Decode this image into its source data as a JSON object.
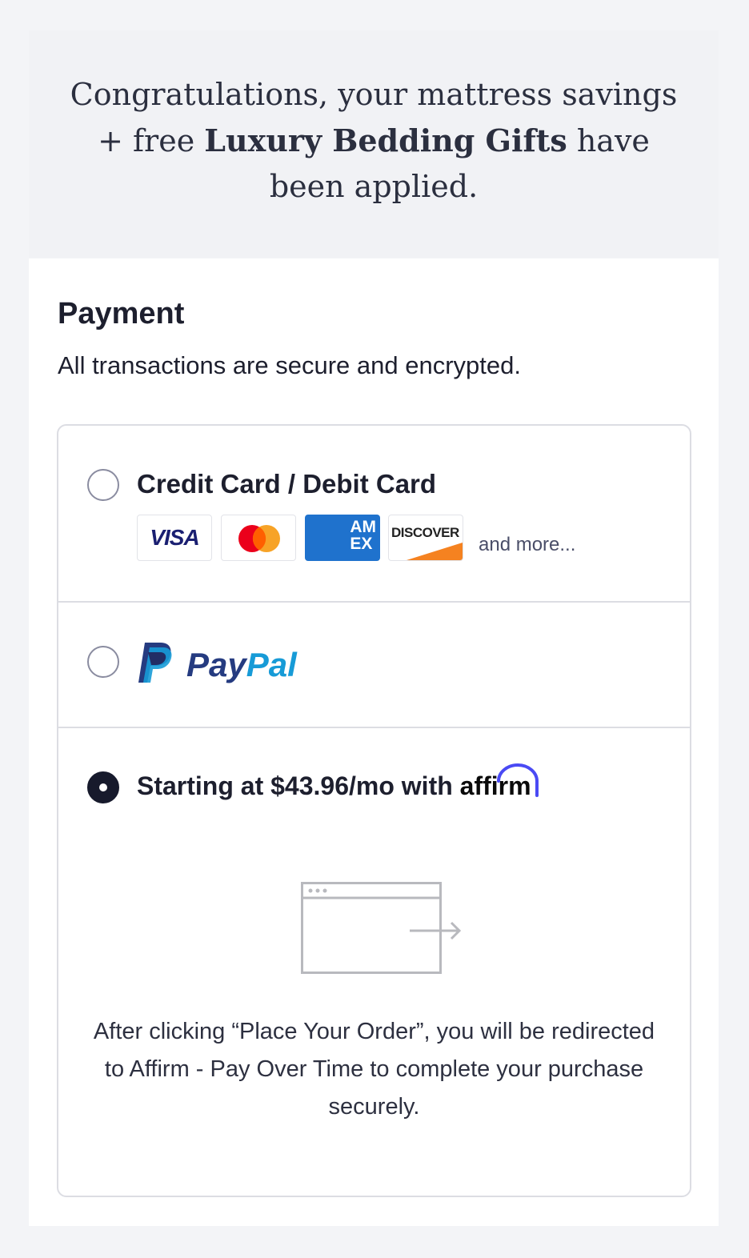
{
  "promo": {
    "before": "Congratulations, your mattress savings + free ",
    "highlight": "Luxury Bedding Gifts",
    "after": " have been applied."
  },
  "payment": {
    "title": "Payment",
    "subtitle": "All transactions are secure and encrypted."
  },
  "options": {
    "card": {
      "label": "Credit Card / Debit Card",
      "selected": false,
      "logos": {
        "visa": "VISA",
        "amex_line1": "AM",
        "amex_line2": "EX",
        "discover": "DISCOVER"
      },
      "more": "and more..."
    },
    "paypal": {
      "label_pay": "Pay",
      "label_pal": "Pal",
      "selected": false
    },
    "affirm": {
      "label": "Starting at $43.96/mo with ",
      "brand": "affirm",
      "selected": true,
      "description": "After clicking “Place Your Order”, you will be redirected to Affirm - Pay Over Time to complete your purchase securely."
    }
  },
  "icons": {
    "paypal": "paypal-logo-icon",
    "affirm": "affirm-arc-icon",
    "redirect": "browser-redirect-icon",
    "mastercard": "mastercard-icon"
  },
  "colors": {
    "selected_radio": "#171a2c",
    "paypal_dark": "#253b80",
    "paypal_light": "#179bd7",
    "affirm_blue": "#4a4af4",
    "amex_blue": "#1f72cd",
    "discover_orange": "#f58220"
  }
}
